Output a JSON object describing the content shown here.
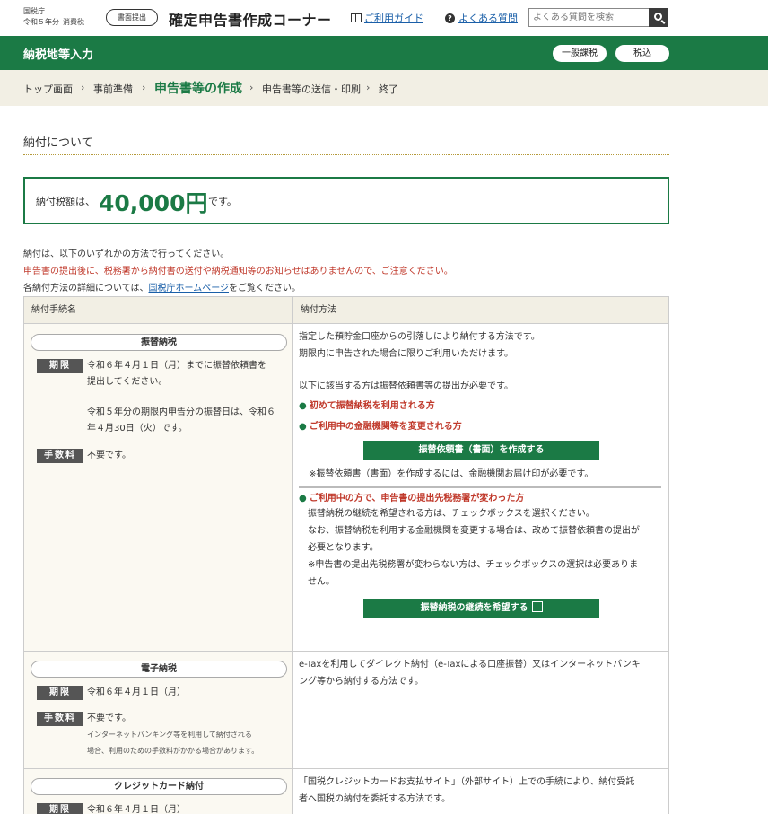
{
  "header": {
    "agency": "国税庁",
    "year": "令和５年分",
    "tax_type": "消費税",
    "paper_badge": "書面提出",
    "site_title": "確定申告書作成コーナー",
    "guide_link": "ご利用ガイド",
    "faq_link": "よくある質問",
    "search_placeholder": "よくある質問を検索"
  },
  "greenbar": {
    "title": "納税地等入力",
    "pill1": "一般課税",
    "pill2": "税込"
  },
  "breadcrumb": [
    "トップ画面",
    "事前準備",
    "申告書等の作成",
    "申告書等の送信・印刷",
    "終了"
  ],
  "section": {
    "title": "納付について",
    "amount_label": "納付税額は、",
    "amount_value": "40,000円",
    "amount_suffix": "です。",
    "note1": "納付は、以下のいずれかの方法で行ってください。",
    "note2": "申告書の提出後に、税務署から納付書の送付や納税通知等のお知らせはありませんので、ご注意ください。",
    "note3_pre": "各納付方法の詳細については、",
    "note3_link": "国税庁ホームページ",
    "note3_post": "をご覧ください。"
  },
  "table": {
    "col1": "納付手続名",
    "col2": "納付方法",
    "rows": [
      {
        "name": "振替納税",
        "deadline_tag": "期限",
        "deadline_text1": "令和６年４月１日（月）までに振替依頼書を",
        "deadline_text2": "提出してください。",
        "deadline_text3": "令和５年分の期限内申告分の振替日は、令和６",
        "deadline_text4": "年４月30日（火）です。",
        "fee_tag": "手数料",
        "fee_text": "不要です。",
        "desc1": "指定した預貯金口座からの引落しにより納付する方法です。",
        "desc2": "期限内に申告された場合に限りご利用いただけます。",
        "desc3": "以下に該当する方は振替依頼書等の提出が必要です。",
        "bullet1": "初めて振替納税を利用される方",
        "bullet2": "ご利用中の金融機関等を変更される方",
        "btn1": "振替依頼書（書面）を作成する",
        "btn1_note": "※振替依頼書（書面）を作成するには、金融機関お届け印が必要です。",
        "bullet3": "ご利用中の方で、申告書の提出先税務署が変わった方",
        "desc4": "振替納税の継続を希望される方は、チェックボックスを選択ください。",
        "desc5": "なお、振替納税を利用する金融機関を変更する場合は、改めて振替依頼書の提出が",
        "desc6": "必要となります。",
        "desc7": "※申告書の提出先税務署が変わらない方は、チェックボックスの選択は必要ありま",
        "desc8": "せん。",
        "btn2": "振替納税の継続を希望する"
      },
      {
        "name": "電子納税",
        "deadline_tag": "期限",
        "deadline_text1": "令和６年４月１日（月）",
        "fee_tag": "手数料",
        "fee_text": "不要です。",
        "fee_note1": "インターネットバンキング等を利用して納付される",
        "fee_note2": "場合、利用のための手数料がかかる場合があります。",
        "desc1": "e-Taxを利用してダイレクト納付（e-Taxによる口座振替）又はインターネットバンキ",
        "desc2": "ング等から納付する方法です。"
      },
      {
        "name": "クレジットカード納付",
        "deadline_tag": "期限",
        "deadline_text1": "令和６年４月１日（月）",
        "desc1": "「国税クレジットカードお支払サイト」（外部サイト）上での手続により、納付受託",
        "desc2": "者へ国税の納付を委託する方法です。"
      }
    ]
  }
}
